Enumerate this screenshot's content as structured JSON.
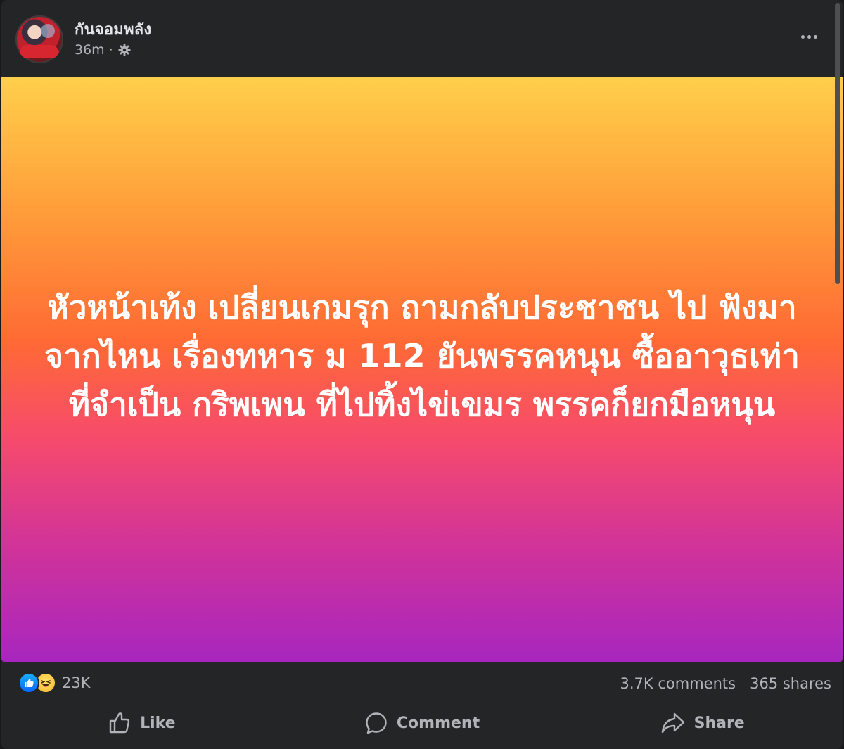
{
  "post": {
    "author": "กันจอมพลัง",
    "time": "36m",
    "separator": "·",
    "privacy_icon": "gear-icon",
    "menu_icon": "more-options-icon",
    "text": "หัวหน้าเท้ง เปลี่ยนเกมรุก ถามกลับประชาชน ไป ฟังมาจากไหน เรื่องทหาร ม 112 ยันพรรคหนุน ซื้ออาวุธเท่าที่จำเป็น กริพเพน ที่ไปทิ้งไข่เขมร พรรคก็ยกมือหนุน",
    "background_colors": [
      "#ffcf4a",
      "#ff6a34",
      "#a726bf"
    ]
  },
  "stats": {
    "reaction_icons": [
      "like-reaction-icon",
      "haha-reaction-icon"
    ],
    "reactions_count": "23K",
    "comments": "3.7K comments",
    "shares": "365 shares"
  },
  "actions": {
    "like_label": "Like",
    "comment_label": "Comment",
    "share_label": "Share"
  }
}
